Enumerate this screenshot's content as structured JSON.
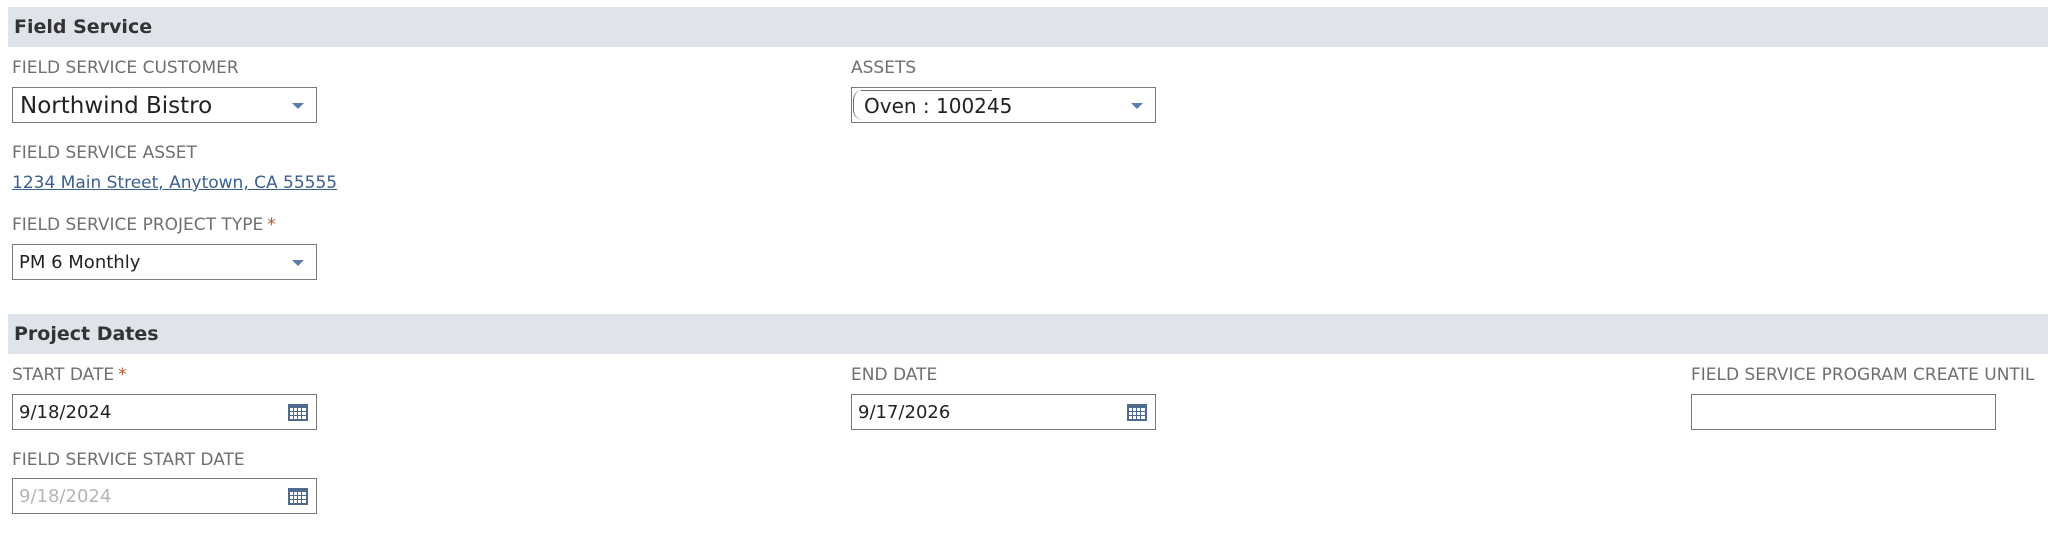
{
  "sections": {
    "field_service": {
      "title": "Field Service"
    },
    "project_dates": {
      "title": "Project Dates"
    }
  },
  "fields": {
    "customer": {
      "label": "FIELD SERVICE CUSTOMER",
      "value": "Northwind Bistro",
      "icon": "chevron-down-icon"
    },
    "assets": {
      "label": "ASSETS",
      "value": "Oven : 100245",
      "icon": "chevron-down-icon"
    },
    "asset": {
      "label": "FIELD SERVICE ASSET",
      "link_text": "1234 Main Street, Anytown, CA 55555"
    },
    "project_type": {
      "label": "FIELD SERVICE PROJECT TYPE",
      "required_mark": "*",
      "value": "PM 6 Monthly",
      "icon": "chevron-down-icon"
    },
    "start_date": {
      "label": "START DATE",
      "required_mark": "*",
      "value": "9/18/2024",
      "icon": "calendar-icon"
    },
    "end_date": {
      "label": "END DATE",
      "value": "9/17/2026",
      "icon": "calendar-icon"
    },
    "program_create_until": {
      "label": "FIELD SERVICE PROGRAM CREATE UNTIL",
      "value": ""
    },
    "fs_start_date": {
      "label": "FIELD SERVICE START DATE",
      "value": "9/18/2024",
      "icon": "calendar-icon"
    }
  },
  "colors": {
    "section_bg": "#dfe4eb",
    "link": "#3a5f8f",
    "required": "#b8531f",
    "icon": "#4e6a8f"
  }
}
